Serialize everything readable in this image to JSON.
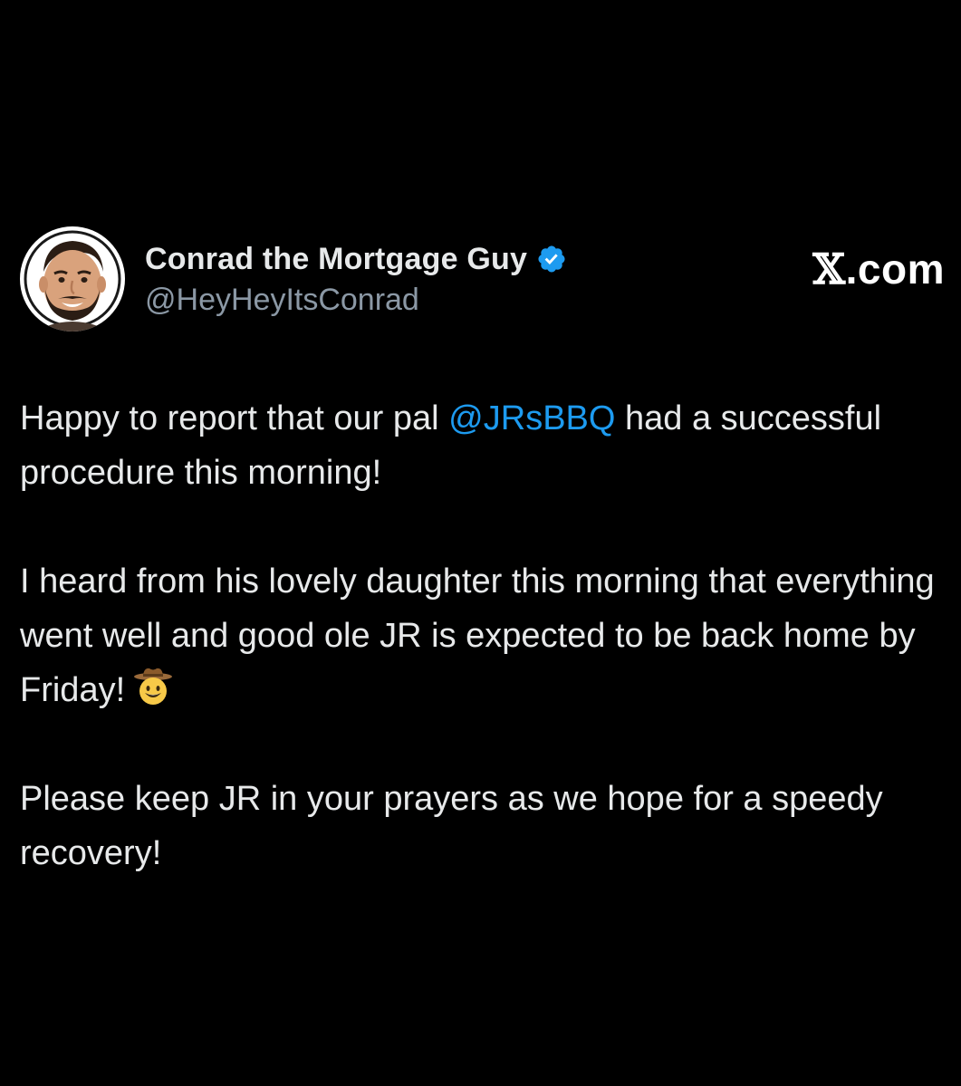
{
  "author": {
    "display_name": "Conrad the Mortgage Guy",
    "handle": "@HeyHeyItsConrad",
    "verified_icon": "verified-badge-icon",
    "avatar": "profile-photo"
  },
  "brand": {
    "prefix": "𝕏",
    "suffix": ".com"
  },
  "tweet": {
    "p1_before": "Happy to report that our pal ",
    "p1_mention": "@JRsBBQ",
    "p1_after": " had a successful procedure this morning!",
    "p2_text": "I heard from his lovely daughter this morning that everything went well and good ole JR is expected to be back home by Friday!",
    "p2_emoji": "cowboy-hat-face-emoji",
    "p3_text": "Please keep JR in your prayers as we hope for a speedy recovery!"
  },
  "colors": {
    "background": "#000000",
    "text": "#e7e9ea",
    "secondary_text": "#8b98a5",
    "link": "#1d9bf0",
    "verified": "#1d9bf0"
  }
}
